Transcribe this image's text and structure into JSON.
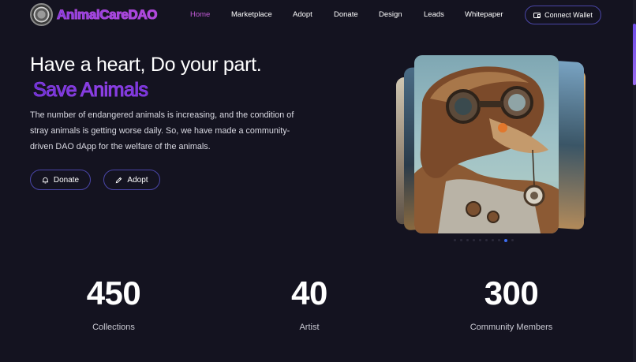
{
  "brand": {
    "name": "AnimalCareDAO",
    "logo_icon": "logo-icon"
  },
  "nav": {
    "items": [
      {
        "label": "Home",
        "active": true
      },
      {
        "label": "Marketplace",
        "active": false
      },
      {
        "label": "Adopt",
        "active": false
      },
      {
        "label": "Donate",
        "active": false
      },
      {
        "label": "Design",
        "active": false
      },
      {
        "label": "Leads",
        "active": false
      },
      {
        "label": "Whitepaper",
        "active": false
      }
    ],
    "wallet_button": {
      "label": "Connect Wallet",
      "icon": "wallet-icon"
    }
  },
  "hero": {
    "headline": "Have a heart, Do your part.",
    "highlight": "Save Animals",
    "description": "The number of endangered animals is increasing, and the condition of stray animals is getting worse daily. So, we have made a community-driven DAO dApp for the welfare of the animals.",
    "buttons": [
      {
        "label": "Donate",
        "icon": "bell-icon"
      },
      {
        "label": "Adopt",
        "icon": "pencil-icon"
      }
    ]
  },
  "carousel": {
    "slides": 10,
    "active_slide": 9
  },
  "stats": [
    {
      "value": "450",
      "label": "Collections"
    },
    {
      "value": "40",
      "label": "Artist"
    },
    {
      "value": "300",
      "label": "Community Members"
    }
  ],
  "colors": {
    "background": "#141320",
    "accent_purple": "#c15ad6",
    "button_border": "#4a46a8",
    "active_dot": "#3d6cf0"
  }
}
